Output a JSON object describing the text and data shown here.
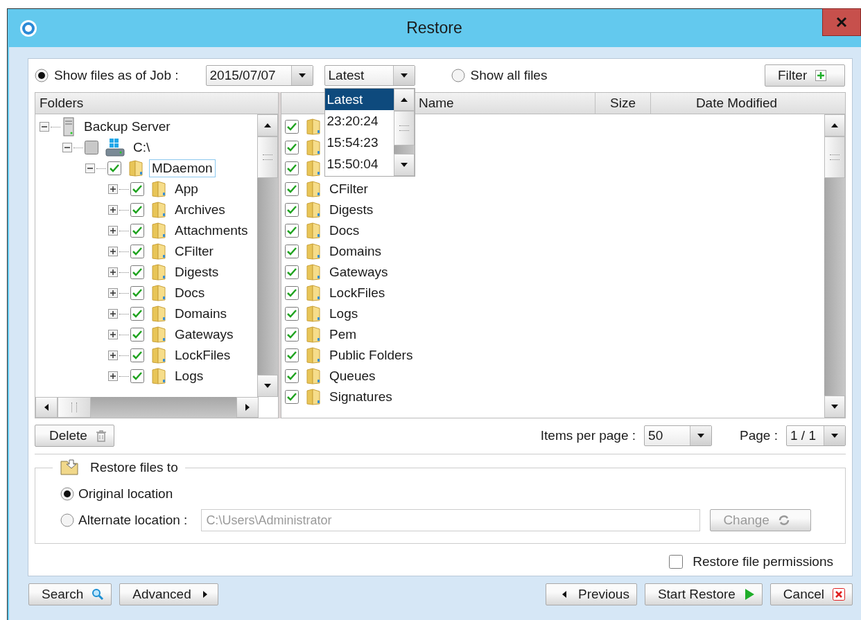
{
  "window": {
    "title": "Restore"
  },
  "job_option": {
    "label": "Show files as of Job :",
    "selected": true,
    "date": "2015/07/07",
    "time": "Latest",
    "time_options": [
      {
        "label": "Latest",
        "selected": true
      },
      {
        "label": "23:20:24",
        "selected": false
      },
      {
        "label": "15:54:23",
        "selected": false
      },
      {
        "label": "15:50:04",
        "selected": false
      }
    ]
  },
  "all_files_option": {
    "label": "Show all files",
    "selected": false
  },
  "filter_button": "Filter",
  "folders": {
    "header": "Folders",
    "tree": [
      {
        "label": "Backup Server",
        "kind": "server",
        "expanded": true,
        "selected": false,
        "children": [
          {
            "label": "C:\\",
            "kind": "drive",
            "expanded": true,
            "checked": false,
            "partial": true,
            "selected": false,
            "children": [
              {
                "label": "MDaemon",
                "kind": "folder",
                "expanded": true,
                "checked": true,
                "partial": false,
                "selected": true,
                "children": [
                  {
                    "label": "App",
                    "kind": "folder",
                    "expanded": false,
                    "checked": true,
                    "partial": false,
                    "selected": false
                  },
                  {
                    "label": "Archives",
                    "kind": "folder",
                    "expanded": false,
                    "checked": true,
                    "partial": false,
                    "selected": false
                  },
                  {
                    "label": "Attachments",
                    "kind": "folder",
                    "expanded": false,
                    "checked": true,
                    "partial": false,
                    "selected": false
                  },
                  {
                    "label": "CFilter",
                    "kind": "folder",
                    "expanded": false,
                    "checked": true,
                    "partial": false,
                    "selected": false
                  },
                  {
                    "label": "Digests",
                    "kind": "folder",
                    "expanded": false,
                    "checked": true,
                    "partial": false,
                    "selected": false
                  },
                  {
                    "label": "Docs",
                    "kind": "folder",
                    "expanded": false,
                    "checked": true,
                    "partial": false,
                    "selected": false
                  },
                  {
                    "label": "Domains",
                    "kind": "folder",
                    "expanded": false,
                    "checked": true,
                    "partial": false,
                    "selected": false
                  },
                  {
                    "label": "Gateways",
                    "kind": "folder",
                    "expanded": false,
                    "checked": true,
                    "partial": false,
                    "selected": false
                  },
                  {
                    "label": "LockFiles",
                    "kind": "folder",
                    "expanded": false,
                    "checked": true,
                    "partial": false,
                    "selected": false
                  },
                  {
                    "label": "Logs",
                    "kind": "folder",
                    "expanded": false,
                    "checked": true,
                    "partial": false,
                    "selected": false
                  }
                ]
              }
            ]
          }
        ]
      }
    ]
  },
  "files": {
    "columns": [
      "Name",
      "Size",
      "Date Modified"
    ],
    "rows": [
      {
        "checked": true
      },
      {
        "checked": true
      },
      {
        "checked": true
      },
      {
        "name": "CFilter",
        "checked": true
      },
      {
        "name": "Digests",
        "checked": true
      },
      {
        "name": "Docs",
        "checked": true
      },
      {
        "name": "Domains",
        "checked": true
      },
      {
        "name": "Gateways",
        "checked": true
      },
      {
        "name": "LockFiles",
        "checked": true
      },
      {
        "name": "Logs",
        "checked": true
      },
      {
        "name": "Pem",
        "checked": true
      },
      {
        "name": "Public Folders",
        "checked": true
      },
      {
        "name": "Queues",
        "checked": true
      },
      {
        "name": "Signatures",
        "checked": true
      }
    ]
  },
  "delete_button": "Delete",
  "items_per_page": {
    "label": "Items per page :",
    "value": "50"
  },
  "page": {
    "label": "Page :",
    "value": "1 / 1"
  },
  "restore_to": {
    "title": "Restore files to",
    "options": [
      {
        "label": "Original location",
        "selected": true
      },
      {
        "label": "Alternate location :",
        "selected": false
      }
    ],
    "path": {
      "value": "C:\\Users\\Administrator",
      "disabled": true
    },
    "change_button": {
      "label": "Change",
      "disabled": true
    }
  },
  "permissions": {
    "label": "Restore file permissions",
    "checked": false
  },
  "buttons": [
    {
      "label": "Search",
      "kind": "search"
    },
    {
      "label": "Advanced",
      "kind": "advanced"
    },
    {
      "label": "Previous",
      "kind": "previous"
    },
    {
      "label": "Start Restore",
      "kind": "start"
    },
    {
      "label": "Cancel",
      "kind": "cancel"
    }
  ]
}
